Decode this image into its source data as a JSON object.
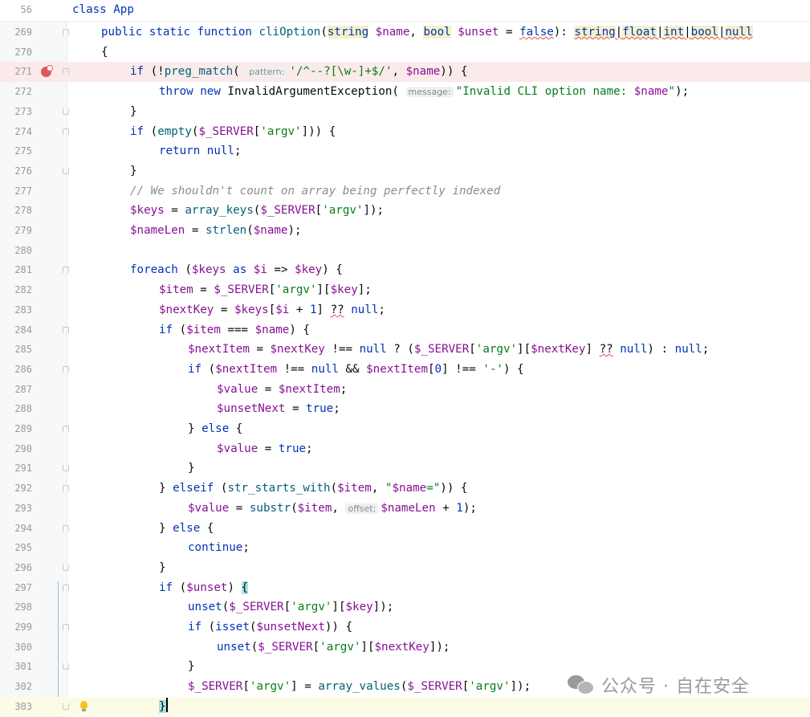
{
  "sticky_header": {
    "line_number": "56",
    "text": "class App"
  },
  "watermark": {
    "text": "公众号 · 自在安全"
  },
  "line_numbers": [
    "269",
    "270",
    "271",
    "272",
    "273",
    "274",
    "275",
    "276",
    "277",
    "278",
    "279",
    "280",
    "281",
    "282",
    "283",
    "284",
    "285",
    "286",
    "287",
    "288",
    "289",
    "290",
    "291",
    "292",
    "293",
    "294",
    "295",
    "296",
    "297",
    "298",
    "299",
    "300",
    "301",
    "302",
    "303"
  ],
  "code": {
    "l269": {
      "t1": "public static function ",
      "t2": "cliOption",
      "t3": "(",
      "t4": "string",
      "t5": " $name",
      "t6": ", ",
      "t7": "bool",
      "t8": " $unset",
      "t9": " = ",
      "t10": "false",
      "t11": "): ",
      "t12": "string",
      "t13": "|",
      "t14": "float",
      "t15": "|",
      "t16": "int",
      "t17": "|",
      "t18": "bool",
      "t19": "|",
      "t20": "null"
    },
    "l270": {
      "t1": "{"
    },
    "l271": {
      "t1": "if",
      "t2": " (!",
      "t3": "preg_match",
      "t4": "(",
      "hint": "pattern:",
      "t5": "'/^--?[\\w-]+$/'",
      "t6": ", ",
      "t7": "$name",
      "t8": ")) {"
    },
    "l272": {
      "t1": "throw new ",
      "t2": "InvalidArgumentException(",
      "hint": "message:",
      "t3": "\"Invalid CLI option name: ",
      "t4": "$name",
      "t5": "\"",
      "t6": ");"
    },
    "l273": {
      "t1": "}"
    },
    "l274": {
      "t1": "if",
      "t2": " (",
      "t3": "empty",
      "t4": "(",
      "t5": "$_SERVER",
      "t6": "[",
      "t7": "'argv'",
      "t8": "])) {"
    },
    "l275": {
      "t1": "return null",
      "t2": ";"
    },
    "l276": {
      "t1": "}"
    },
    "l277": {
      "t1": "// We shouldn't count on array being perfectly indexed"
    },
    "l278": {
      "t1": "$keys",
      "t2": " = ",
      "t3": "array_keys",
      "t4": "(",
      "t5": "$_SERVER",
      "t6": "[",
      "t7": "'argv'",
      "t8": "]);"
    },
    "l279": {
      "t1": "$nameLen",
      "t2": " = ",
      "t3": "strlen",
      "t4": "(",
      "t5": "$name",
      "t6": ");"
    },
    "l281": {
      "t1": "foreach",
      "t2": " (",
      "t3": "$keys",
      "t4": " as ",
      "t5": "$i",
      "t6": " => ",
      "t7": "$key",
      "t8": ") {"
    },
    "l282": {
      "t1": "$item",
      "t2": " = ",
      "t3": "$_SERVER",
      "t4": "[",
      "t5": "'argv'",
      "t6": "][",
      "t7": "$key",
      "t8": "];"
    },
    "l283": {
      "t1": "$nextKey",
      "t2": " = ",
      "t3": "$keys",
      "t4": "[",
      "t5": "$i",
      "t6": " + ",
      "t7": "1",
      "t8": "] ",
      "t9": "??",
      "t10": " null",
      "t11": ";"
    },
    "l284": {
      "t1": "if",
      "t2": " (",
      "t3": "$item",
      "t4": " === ",
      "t5": "$name",
      "t6": ") {"
    },
    "l285": {
      "t1": "$nextItem",
      "t2": " = ",
      "t3": "$nextKey",
      "t4": " !== ",
      "t5": "null",
      "t6": " ? (",
      "t7": "$_SERVER",
      "t8": "[",
      "t9": "'argv'",
      "t10": "][",
      "t11": "$nextKey",
      "t12": "] ",
      "t13": "??",
      "t14": " null",
      "t15": ") : ",
      "t16": "null",
      "t17": ";"
    },
    "l286": {
      "t1": "if",
      "t2": " (",
      "t3": "$nextItem",
      "t4": " !== ",
      "t5": "null",
      "t6": " && ",
      "t7": "$nextItem",
      "t8": "[",
      "t9": "0",
      "t10": "] !== ",
      "t11": "'-'",
      "t12": ") {"
    },
    "l287": {
      "t1": "$value",
      "t2": " = ",
      "t3": "$nextItem",
      "t4": ";"
    },
    "l288": {
      "t1": "$unsetNext",
      "t2": " = ",
      "t3": "true",
      "t4": ";"
    },
    "l289": {
      "t1": "} ",
      "t2": "else",
      "t3": " {"
    },
    "l290": {
      "t1": "$value",
      "t2": " = ",
      "t3": "true",
      "t4": ";"
    },
    "l291": {
      "t1": "}"
    },
    "l292": {
      "t1": "} ",
      "t2": "elseif",
      "t3": " (",
      "t4": "str_starts_with",
      "t5": "(",
      "t6": "$item",
      "t7": ", ",
      "t8": "\"",
      "t9": "$name",
      "t10": "=\"",
      "t11": ")) {"
    },
    "l293": {
      "t1": "$value",
      "t2": " = ",
      "t3": "substr",
      "t4": "(",
      "t5": "$item",
      "t6": ", ",
      "hint": "offset:",
      "t7": "$nameLen",
      "t8": " + ",
      "t9": "1",
      "t10": ");"
    },
    "l294": {
      "t1": "} ",
      "t2": "else",
      "t3": " {"
    },
    "l295": {
      "t1": "continue",
      "t2": ";"
    },
    "l296": {
      "t1": "}"
    },
    "l297": {
      "t1": "if",
      "t2": " (",
      "t3": "$unset",
      "t4": ") ",
      "t5": "{"
    },
    "l298": {
      "t1": "unset",
      "t2": "(",
      "t3": "$_SERVER",
      "t4": "[",
      "t5": "'argv'",
      "t6": "][",
      "t7": "$key",
      "t8": "]);"
    },
    "l299": {
      "t1": "if",
      "t2": " (",
      "t3": "isset",
      "t4": "(",
      "t5": "$unsetNext",
      "t6": ")) {"
    },
    "l300": {
      "t1": "unset",
      "t2": "(",
      "t3": "$_SERVER",
      "t4": "[",
      "t5": "'argv'",
      "t6": "][",
      "t7": "$nextKey",
      "t8": "]);"
    },
    "l301": {
      "t1": "}"
    },
    "l302": {
      "t1": "$_SERVER",
      "t2": "[",
      "t3": "'argv'",
      "t4": "] = ",
      "t5": "array_values",
      "t6": "(",
      "t7": "$_SERVER",
      "t8": "[",
      "t9": "'argv'",
      "t10": "]);"
    },
    "l303": {
      "t1": "}"
    }
  }
}
